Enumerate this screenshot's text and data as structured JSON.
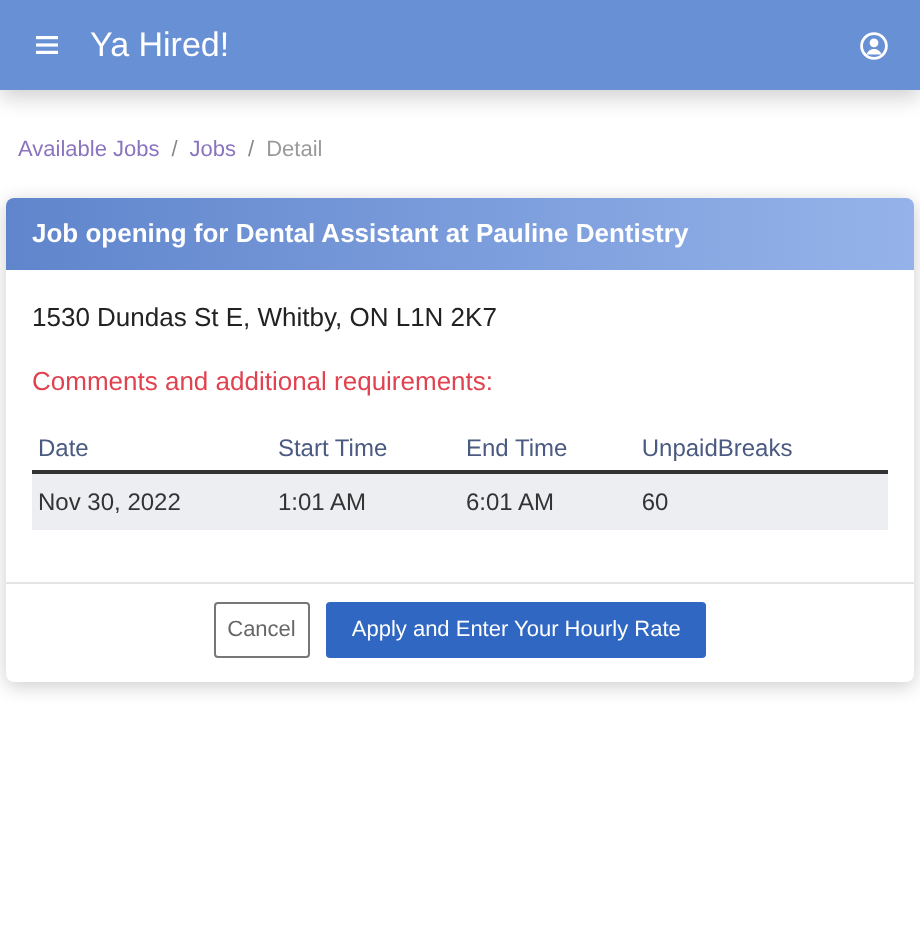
{
  "app_bar": {
    "title": "Ya Hired!"
  },
  "breadcrumb": [
    {
      "label": "Available Jobs",
      "active": false
    },
    {
      "separator": "/",
      "label": "Jobs",
      "active": false
    },
    {
      "separator": "/",
      "label": "Detail",
      "active": true
    }
  ],
  "card": {
    "title": "Job opening for Dental Assistant at Pauline Dentistry",
    "address": "1530 Dundas St E, Whitby, ON L1N 2K7",
    "comments_label": "Comments and additional requirements:",
    "table": {
      "columns": [
        "Date",
        "Start Time",
        "End Time",
        "UnpaidBreaks"
      ],
      "rows": [
        [
          "Nov 30, 2022",
          "1:01 AM",
          "6:01 AM",
          "60"
        ]
      ]
    },
    "buttons": [
      {
        "label": "Cancel",
        "kind": "secondary"
      },
      {
        "label": "Apply and Enter Your Hourly Rate",
        "kind": "primary"
      }
    ]
  }
}
